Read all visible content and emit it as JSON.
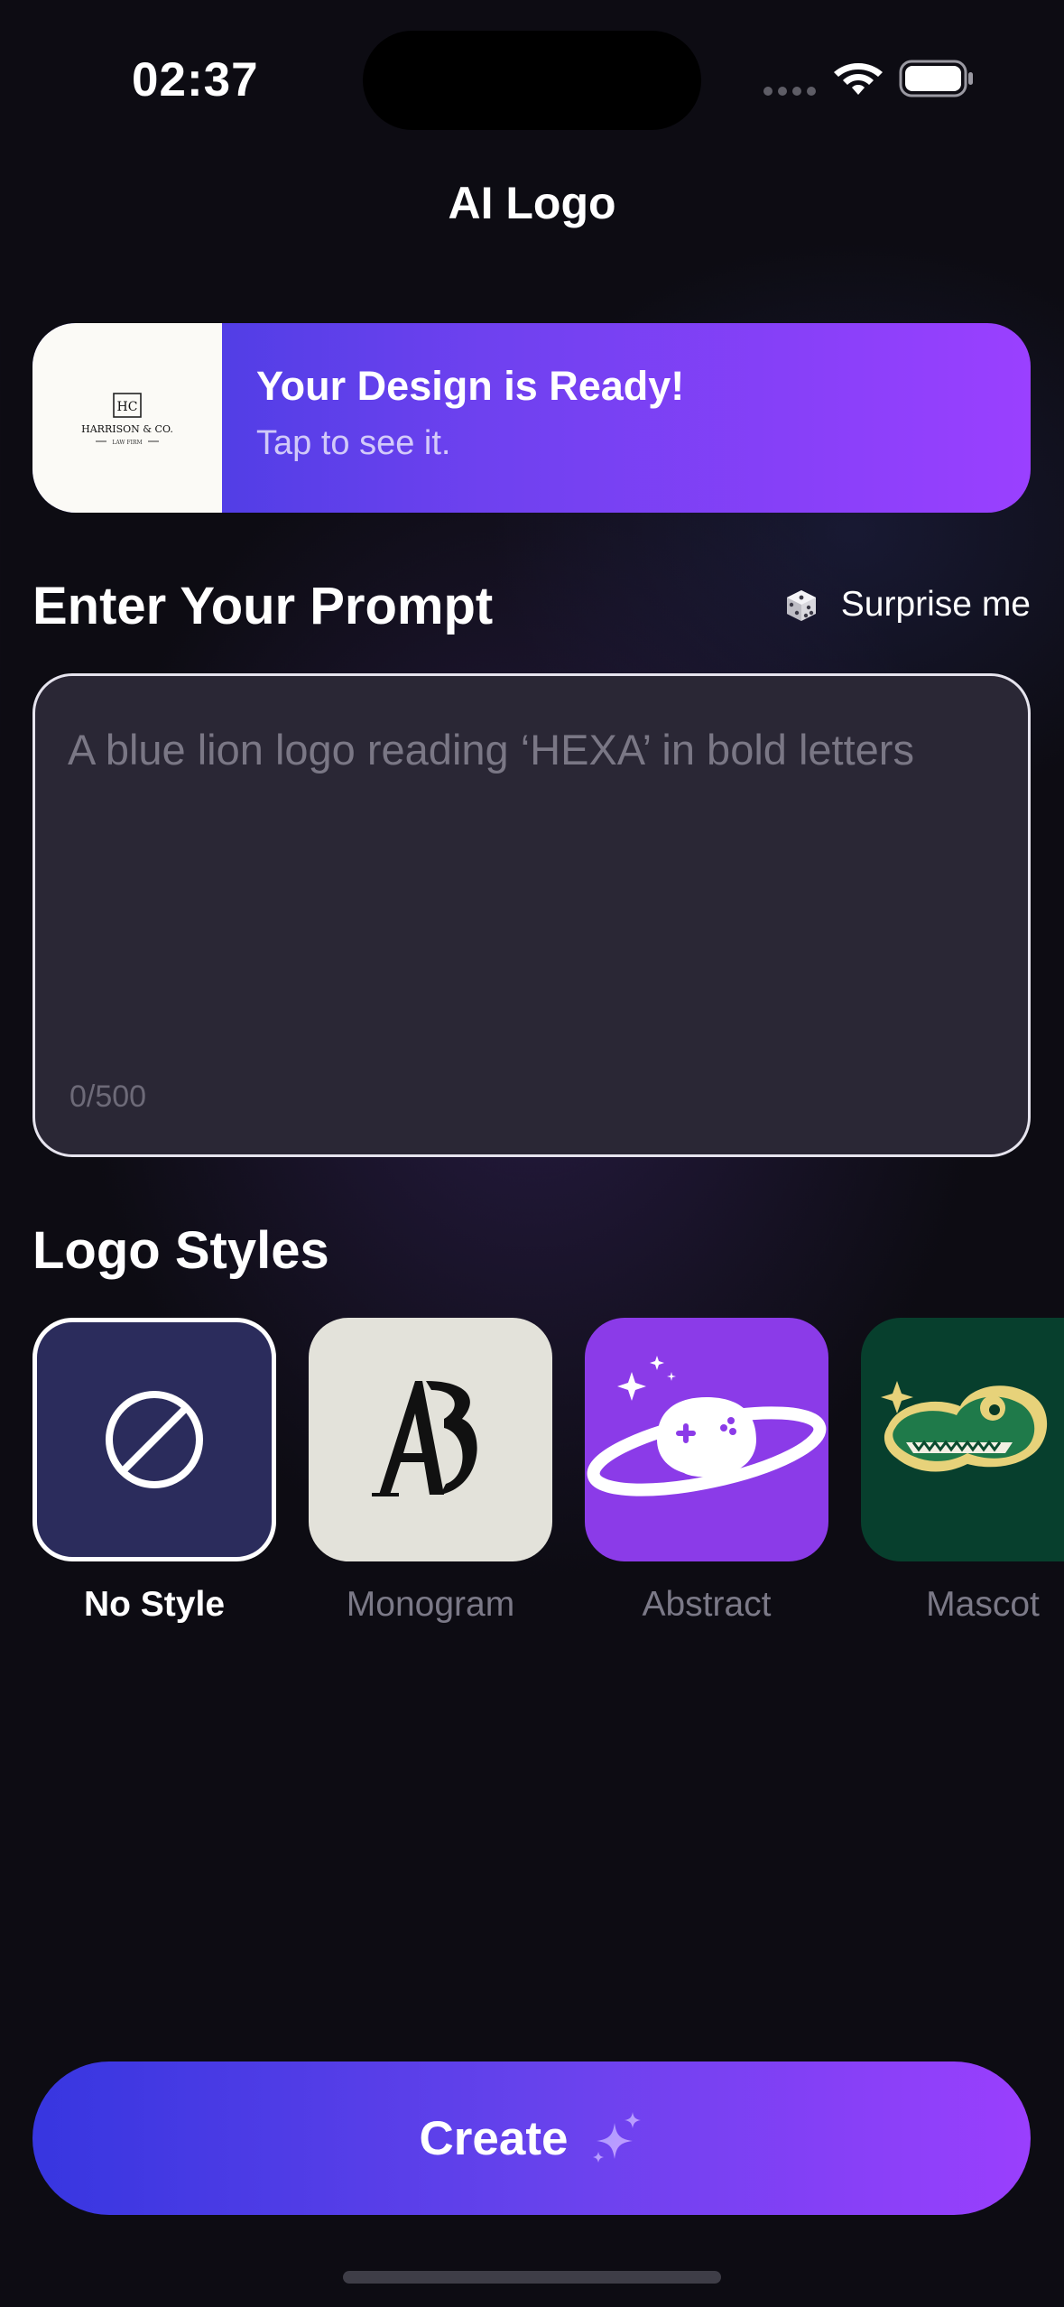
{
  "status_bar": {
    "time": "02:37",
    "wifi_icon": "wifi-icon",
    "battery_icon": "battery-icon"
  },
  "header": {
    "title": "AI Logo"
  },
  "banner": {
    "title": "Your Design is Ready!",
    "subtitle": "Tap to see it.",
    "thumbnail": {
      "monogram": "HC",
      "firm_name": "HARRISON & CO.",
      "tagline": "LAW FIRM"
    }
  },
  "prompt": {
    "section_title": "Enter Your Prompt",
    "surprise_label": "Surprise me",
    "surprise_icon": "dice-icon",
    "value": "",
    "placeholder": "A blue lion logo reading ‘HEXA’ in bold letters",
    "char_count": "0/500"
  },
  "logo_styles": {
    "section_title": "Logo Styles",
    "selected": "No Style",
    "items": [
      {
        "label": "No Style",
        "icon": "no-style-icon"
      },
      {
        "label": "Monogram",
        "icon": "monogram-icon"
      },
      {
        "label": "Abstract",
        "icon": "abstract-planet-icon"
      },
      {
        "label": "Mascot",
        "icon": "crocodile-mascot-icon"
      }
    ]
  },
  "create_button": {
    "label": "Create",
    "icon": "sparkle-icon"
  },
  "colors": {
    "background": "#0d0c13",
    "gradient_start": "#3736e0",
    "gradient_end": "#9a3ffd",
    "prompt_box": "#2a2735",
    "selected_tile": "#2b2c5c",
    "monogram_tile": "#e3e2da",
    "abstract_tile": "#8b3be8",
    "mascot_tile": "#073f2d"
  }
}
